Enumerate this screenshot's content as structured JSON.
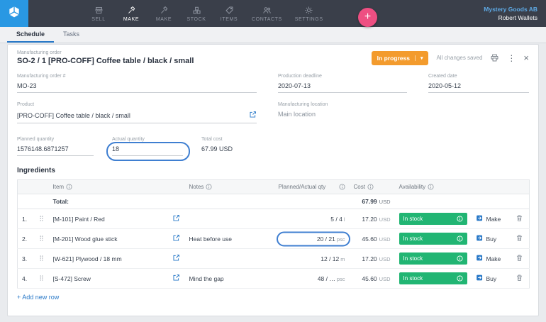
{
  "colors": {
    "brand_blue": "#2998e3",
    "navbar_dark": "#3a3f4a",
    "accent_blue": "#2979c8",
    "status_orange": "#f39b2d",
    "success_green": "#21b573",
    "fab_pink": "#ee4f82",
    "annotation_blue": "#3f7fd1"
  },
  "icons": {
    "plus": "+",
    "caret": "▾",
    "kebab": "⋮",
    "close": "×"
  },
  "nav": {
    "items": [
      {
        "label": "SELL"
      },
      {
        "label": "MAKE"
      },
      {
        "label": "MAKE"
      },
      {
        "label": "STOCK"
      },
      {
        "label": "ITEMS"
      },
      {
        "label": "CONTACTS"
      },
      {
        "label": "SETTINGS"
      }
    ],
    "company": "Mystery Goods AB",
    "user": "Robert Wallets"
  },
  "tabs": {
    "schedule": "Schedule",
    "tasks": "Tasks"
  },
  "order": {
    "type_label": "Manufacturing order",
    "title": "SO-2 / 1 [PRO-COFF] Coffee table / black / small",
    "status": "In progress",
    "saved": "All changes saved",
    "fields": {
      "mo": {
        "label": "Manufacturing order #",
        "value": "MO-23"
      },
      "deadline": {
        "label": "Production deadline",
        "value": "2020-07-13"
      },
      "created": {
        "label": "Created date",
        "value": "2020-05-12"
      },
      "product": {
        "label": "Product",
        "value": "[PRO-COFF] Coffee table / black / small"
      },
      "location": {
        "label": "Manufacturing location",
        "value": "Main location"
      },
      "planned": {
        "label": "Planned quantity",
        "value": "1576148.6871257"
      },
      "actual": {
        "label": "Actual quantity",
        "value": "18"
      },
      "total": {
        "label": "Total cost",
        "value": "67.99 USD"
      }
    }
  },
  "ingredients": {
    "title": "Ingredients",
    "columns": {
      "item": "Item",
      "notes": "Notes",
      "qty": "Planned/Actual qty",
      "cost": "Cost",
      "availability": "Availability"
    },
    "total_label": "Total:",
    "total_cost": "67.99",
    "total_currency": "USD",
    "add_row": "+ Add new row",
    "rows": [
      {
        "num": "1.",
        "item": "[M-101] Paint / Red",
        "notes": "",
        "qty": "5 / 4",
        "unit": "l",
        "cost": "17.20",
        "currency": "USD",
        "availability": "In stock",
        "action": "Make"
      },
      {
        "num": "2.",
        "item": "[M-201] Wood glue stick",
        "notes": "Heat before use",
        "qty": "20 / 21",
        "unit": "psc",
        "cost": "45.60",
        "currency": "USD",
        "availability": "In stock",
        "action": "Buy"
      },
      {
        "num": "3.",
        "item": "[W-621] Plywood / 18 mm",
        "notes": "",
        "qty": "12 / 12",
        "unit": "m",
        "cost": "17.20",
        "currency": "USD",
        "availability": "In stock",
        "action": "Make"
      },
      {
        "num": "4.",
        "item": "[S-472] Screw",
        "notes": "Mind the gap",
        "qty": "48 / …",
        "unit": "psc",
        "cost": "45.60",
        "currency": "USD",
        "availability": "In stock",
        "action": "Buy"
      }
    ]
  }
}
